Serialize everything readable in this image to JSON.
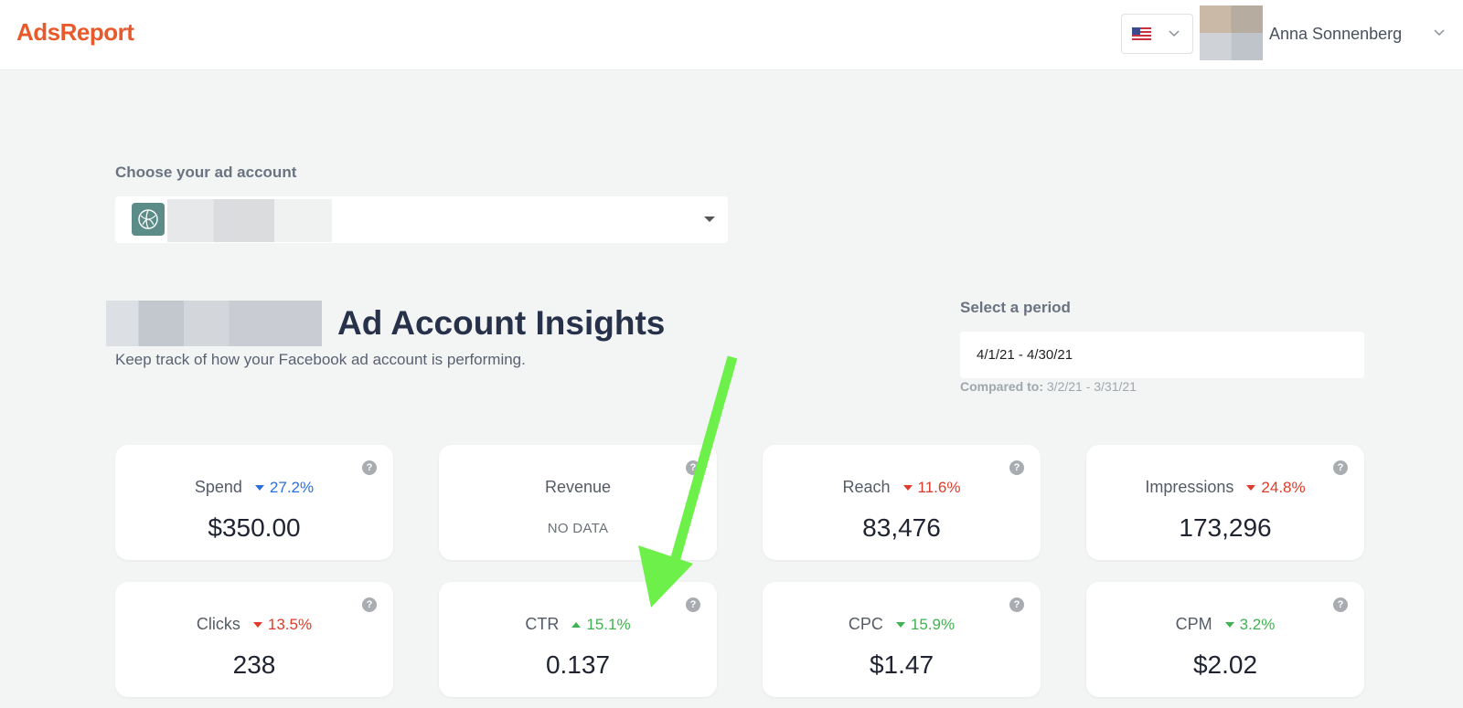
{
  "header": {
    "logo": "AdsReport",
    "language": "flag-us-icon",
    "user_name": "Anna Sonnenberg"
  },
  "account": {
    "label": "Choose your ad account"
  },
  "insights": {
    "title": "Ad Account Insights",
    "subtitle": "Keep track of how your Facebook ad account is performing."
  },
  "period": {
    "label": "Select a period",
    "value": "4/1/21 - 4/30/21",
    "compared_label": "Compared to:",
    "compared_value": "3/2/21 - 3/31/21"
  },
  "metrics": [
    {
      "name": "Spend",
      "change": "27.2%",
      "direction": "down",
      "color": "#2a6fdb",
      "value": "$350.00"
    },
    {
      "name": "Revenue",
      "change": "",
      "direction": "",
      "color": "",
      "value": "NO DATA"
    },
    {
      "name": "Reach",
      "change": "11.6%",
      "direction": "down",
      "color": "#e03a2a",
      "value": "83,476"
    },
    {
      "name": "Impressions",
      "change": "24.8%",
      "direction": "down",
      "color": "#e03a2a",
      "value": "173,296"
    },
    {
      "name": "Clicks",
      "change": "13.5%",
      "direction": "down",
      "color": "#e03a2a",
      "value": "238"
    },
    {
      "name": "CTR",
      "change": "15.1%",
      "direction": "up",
      "color": "#3fb34f",
      "value": "0.137"
    },
    {
      "name": "CPC",
      "change": "15.9%",
      "direction": "down",
      "color": "#3fb34f",
      "value": "$1.47"
    },
    {
      "name": "CPM",
      "change": "3.2%",
      "direction": "down",
      "color": "#3fb34f",
      "value": "$2.02"
    }
  ],
  "help_glyph": "?",
  "colors": {
    "brand": "#e85a2c",
    "annotation_arrow": "#6ef04a"
  }
}
